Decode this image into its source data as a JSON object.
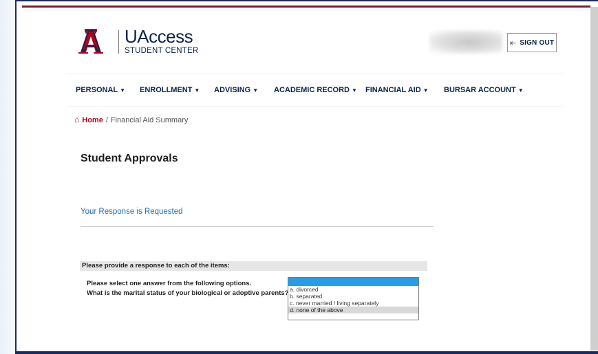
{
  "brand": {
    "title": "UAccess",
    "subtitle": "STUDENT CENTER",
    "logo_color": "#ab0520",
    "navy": "#0c234b"
  },
  "header": {
    "sign_out_label": "SIGN OUT",
    "sign_out_icon": "sign-out-icon"
  },
  "nav": {
    "items": [
      {
        "label": "PERSONAL"
      },
      {
        "label": "ENROLLMENT"
      },
      {
        "label": "ADVISING"
      },
      {
        "label": "ACADEMIC RECORD"
      },
      {
        "label": "FINANCIAL AID"
      },
      {
        "label": "BURSAR ACCOUNT"
      }
    ]
  },
  "breadcrumb": {
    "home_icon": "home-icon",
    "home": "Home",
    "separator": "/",
    "current": "Financial Aid Summary"
  },
  "page": {
    "title": "Student Approvals",
    "response_requested": "Your Response is Requested"
  },
  "form": {
    "section_header": "Please provide a response to each of the items:",
    "question_line1": "Please select one answer from the following options.",
    "question_line2": "What is the marital status of your biological or adoptive parents?",
    "options": [
      "",
      "a. divorced",
      "b. separated",
      "c. never married / living separately",
      "d. none of the above"
    ],
    "selected_index": 4
  }
}
